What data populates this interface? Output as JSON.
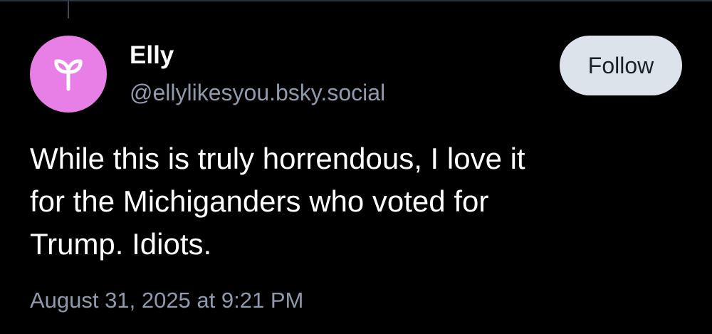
{
  "post": {
    "author": {
      "display_name": "Elly",
      "handle": "@ellylikesyou.bsky.social",
      "avatar_icon": "sprout-icon",
      "avatar_color": "#e87fe6"
    },
    "follow_label": "Follow",
    "text_lines": [
      "While this is truly horrendous, I love it",
      "for the Michiganders who voted for",
      "Trump. Idiots."
    ],
    "timestamp": "August 31, 2025 at 9:21 PM"
  },
  "colors": {
    "background": "#000000",
    "text": "#ffffff",
    "secondary_text": "#8f9bad",
    "button_bg": "#dde3ea",
    "button_text": "#1b2129"
  }
}
